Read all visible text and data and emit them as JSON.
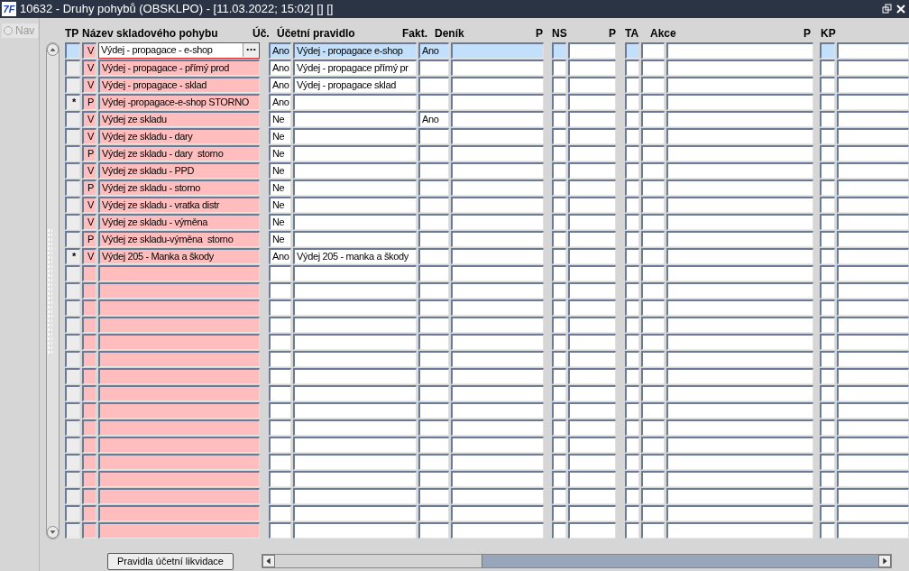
{
  "window": {
    "logo": "7F",
    "title": "10632 - Druhy pohybů (OBSKLPO) - [11.03.2022; 15:02] [] []"
  },
  "nav": {
    "label": "Nav",
    "selected": false
  },
  "columns": [
    "TP",
    "Název skladového pohybu",
    "Úč.",
    "Účetní pravidlo",
    "Fakt.",
    "Deník",
    "P",
    "NS",
    "P",
    "TA",
    "Akce",
    "P",
    "KP"
  ],
  "rows": [
    {
      "selected": true,
      "tp": "V",
      "name": "Výdej - propagace - e-shop",
      "uc": "Ano",
      "rule": "Výdej - propagace e-shop",
      "fakt": "Ano"
    },
    {
      "selected": false,
      "tp": "V",
      "name": "Výdej - propagace - přímý prod",
      "uc": "Ano",
      "rule": "Výdej - propagace přímý pr"
    },
    {
      "selected": false,
      "tp": "V",
      "name": "Výdej - propagace - sklad",
      "uc": "Ano",
      "rule": "Výdej - propagace sklad"
    },
    {
      "selected": false,
      "marker": "*",
      "tp": "P",
      "name": "Výdej -propagace-e-shop STORNO",
      "uc": "Ano"
    },
    {
      "selected": false,
      "tp": "V",
      "name": "Výdej ze skladu",
      "uc": "Ne",
      "fakt": "Ano"
    },
    {
      "selected": false,
      "tp": "V",
      "name": "Výdej ze skladu - dary",
      "uc": "Ne"
    },
    {
      "selected": false,
      "tp": "P",
      "name": "Výdej ze skladu - dary  storno",
      "uc": "Ne"
    },
    {
      "selected": false,
      "tp": "V",
      "name": "Výdej ze skladu - PPD",
      "uc": "Ne"
    },
    {
      "selected": false,
      "tp": "P",
      "name": "Výdej ze skladu - storno",
      "uc": "Ne"
    },
    {
      "selected": false,
      "tp": "V",
      "name": "Výdej ze skladu - vratka distr",
      "uc": "Ne"
    },
    {
      "selected": false,
      "tp": "V",
      "name": "Výdej ze skladu - výměna",
      "uc": "Ne"
    },
    {
      "selected": false,
      "tp": "P",
      "name": "Výdej ze skladu-výměna  storno",
      "uc": "Ne"
    },
    {
      "selected": false,
      "marker": "*",
      "tp": "V",
      "name": "Výdej 205 - Manka a škody",
      "uc": "Ano",
      "rule": "Výdej 205 - manka a škody"
    },
    {
      "selected": false
    },
    {
      "selected": false
    },
    {
      "selected": false
    },
    {
      "selected": false
    },
    {
      "selected": false
    },
    {
      "selected": false
    },
    {
      "selected": false
    },
    {
      "selected": false
    },
    {
      "selected": false
    },
    {
      "selected": false
    },
    {
      "selected": false
    },
    {
      "selected": false
    },
    {
      "selected": false
    },
    {
      "selected": false
    },
    {
      "selected": false
    },
    {
      "selected": false
    }
  ],
  "buttons": [
    "Pravidla účetní likvidace"
  ]
}
